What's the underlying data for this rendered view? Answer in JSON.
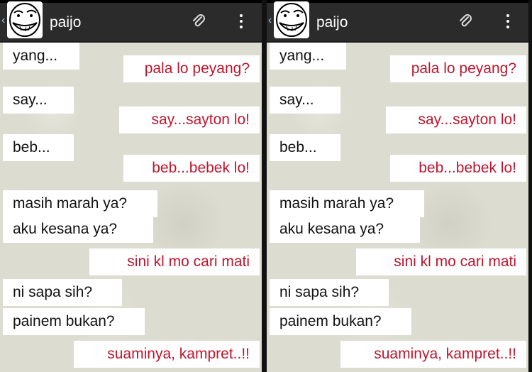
{
  "contact": {
    "name": "paijo"
  },
  "icons": {
    "back": "back-arrow-icon",
    "avatar": "troll-face-avatar",
    "attach": "paperclip-icon",
    "menu": "overflow-menu-icon"
  },
  "colors": {
    "incoming_text": "#111111",
    "outgoing_text": "#c0152d",
    "header_bg": "#2b2b2b",
    "chat_bg": "#dcdcd0"
  },
  "messages": [
    {
      "dir": "in",
      "text": "yang..."
    },
    {
      "dir": "out",
      "text": "pala lo peyang?"
    },
    {
      "dir": "in",
      "text": "say..."
    },
    {
      "dir": "out",
      "text": "say...sayton lo!"
    },
    {
      "dir": "in",
      "text": "beb..."
    },
    {
      "dir": "out",
      "text": "beb...bebek lo!"
    },
    {
      "dir": "in",
      "text": "masih marah ya?"
    },
    {
      "dir": "in",
      "text": "aku kesana ya?"
    },
    {
      "dir": "out",
      "text": "sini kl mo cari mati"
    },
    {
      "dir": "in",
      "text": "ni sapa sih?"
    },
    {
      "dir": "in",
      "text": "painem bukan?"
    },
    {
      "dir": "out",
      "text": "suaminya, kampret..!!"
    }
  ]
}
